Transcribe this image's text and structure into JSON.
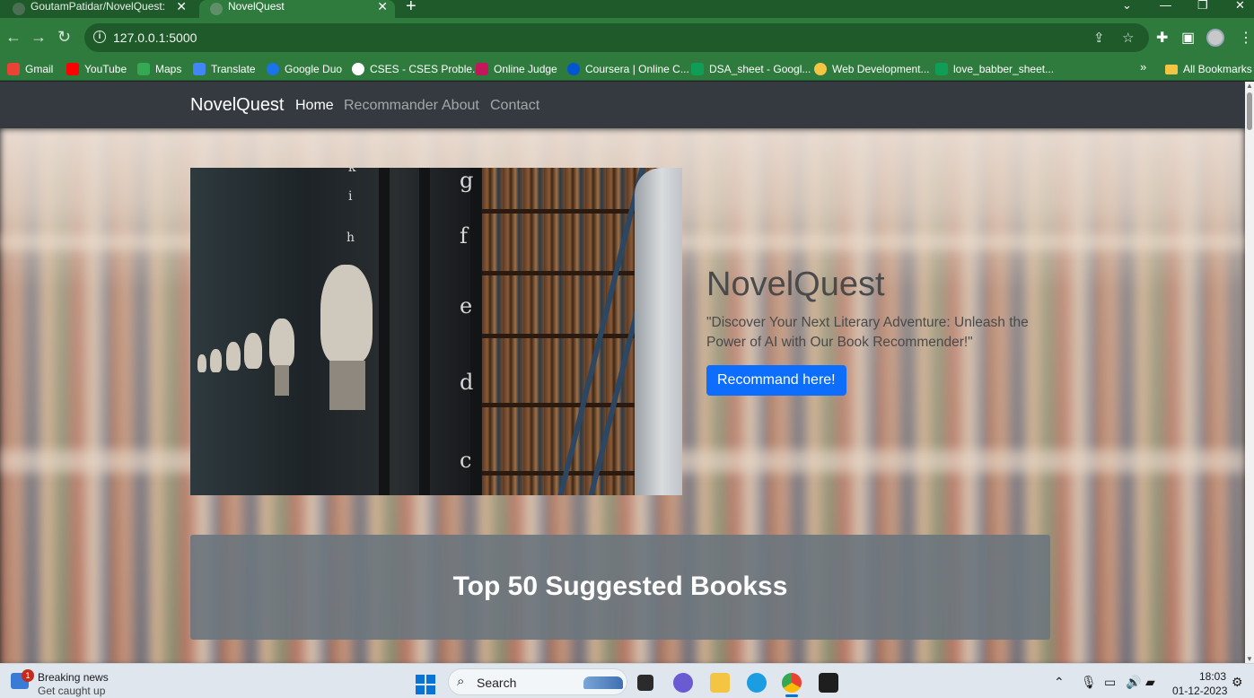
{
  "browser": {
    "tabs": [
      {
        "title": "GoutamPatidar/NovelQuest: \"Nc"
      },
      {
        "title": "NovelQuest"
      }
    ],
    "new_tab": "+",
    "url": "127.0.0.1:5000",
    "bookmarks": [
      {
        "label": "Gmail",
        "color": "#ea4335"
      },
      {
        "label": "YouTube",
        "color": "#ff0000"
      },
      {
        "label": "Maps",
        "color": "#34a853"
      },
      {
        "label": "Translate",
        "color": "#4285f4"
      },
      {
        "label": "Google Duo",
        "color": "#1a73e8"
      },
      {
        "label": "CSES - CSES Proble...",
        "color": "#ffffff"
      },
      {
        "label": "Online Judge",
        "color": "#c2185b"
      },
      {
        "label": "Coursera | Online C...",
        "color": "#0056d2"
      },
      {
        "label": "DSA_sheet - Googl...",
        "color": "#0f9d58"
      },
      {
        "label": "Web Development...",
        "color": "#f4c542"
      },
      {
        "label": "love_babber_sheet...",
        "color": "#0f9d58"
      }
    ],
    "bookmarks_more": "»",
    "all_bookmarks": "All Bookmarks"
  },
  "site": {
    "brand": "NovelQuest",
    "nav": [
      {
        "label": "Home",
        "active": true
      },
      {
        "label": "Recommander",
        "active": false
      },
      {
        "label": "About",
        "active": false
      },
      {
        "label": "Contact",
        "active": false
      }
    ],
    "hero": {
      "title": "NovelQuest",
      "quote": "\"Discover Your Next Literary Adventure: Unleash the Power of AI with Our Book Recommender!\"",
      "button": "Recommand here!",
      "image_letters": [
        "g",
        "f",
        "e",
        "d",
        "c"
      ],
      "image_letters_left": [
        "k",
        "i",
        "h"
      ]
    },
    "section_title": "Top 50 Suggested Bookss"
  },
  "taskbar": {
    "news_title": "Breaking news",
    "news_subtitle": "Get caught up",
    "news_badge": "1",
    "search_label": "Search",
    "time": "18:03",
    "date": "01-12-2023"
  },
  "colors": {
    "chrome_green": "#2f7a3d",
    "navbar": "#343a40",
    "primary_button": "#0d6efd",
    "section_box": "#6c757d"
  }
}
